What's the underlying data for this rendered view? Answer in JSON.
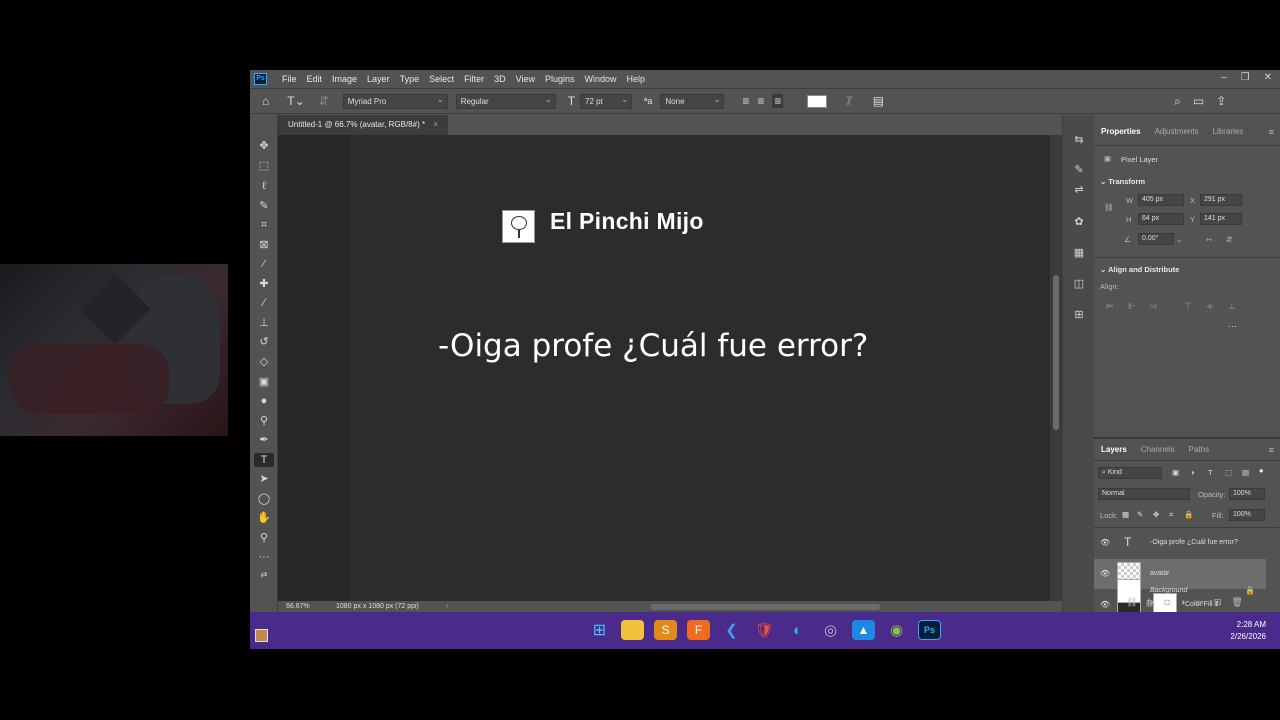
{
  "menu": [
    "File",
    "Edit",
    "Image",
    "Layer",
    "Type",
    "Select",
    "Filter",
    "3D",
    "View",
    "Plugins",
    "Window",
    "Help"
  ],
  "logo": "Ps",
  "options": {
    "font_family": "Myriad Pro",
    "font_style": "Regular",
    "font_size": "72 pt",
    "anti_alias": "None"
  },
  "document_tab": "Untitled-1 @ 66.7% (avatar, RGB/8#) *",
  "canvas": {
    "title": "El Pinchi Mijo",
    "body": "-Oiga profe ¿Cuál fue error?"
  },
  "status": {
    "zoom": "66.67%",
    "dimensions": "1080 px x 1080 px (72 ppi)"
  },
  "properties_panel": {
    "tabs": [
      "Properties",
      "Adjustments",
      "Libraries"
    ],
    "layer_type": "Pixel Layer",
    "transform_heading": "Transform",
    "w_label": "W",
    "w_value": "405 px",
    "x_label": "X",
    "x_value": "291 px",
    "h_label": "H",
    "h_value": "64 px",
    "y_label": "Y",
    "y_value": "141 px",
    "angle_value": "0.00°",
    "align_heading": "Align and Distribute",
    "align_label": "Align:"
  },
  "layers_panel": {
    "tabs": [
      "Layers",
      "Channels",
      "Paths"
    ],
    "filter_kind": "Kind",
    "blend_mode": "Normal",
    "opacity_label": "Opacity:",
    "opacity_value": "100%",
    "lock_label": "Lock:",
    "fill_label": "Fill:",
    "fill_value": "100%",
    "layers": [
      {
        "name": "-Oiga profe ¿Cuál fue error?"
      },
      {
        "name": "avatar"
      },
      {
        "name": "Color Fill 1"
      },
      {
        "name": "Background"
      }
    ]
  },
  "taskbar": {
    "time": "2:28 AM",
    "date": "2/26/2026"
  },
  "colors": {
    "foreground_swatch": "#c28b4e",
    "background_swatch": "#d3b95b",
    "taskbar": "#4a2a8a"
  }
}
